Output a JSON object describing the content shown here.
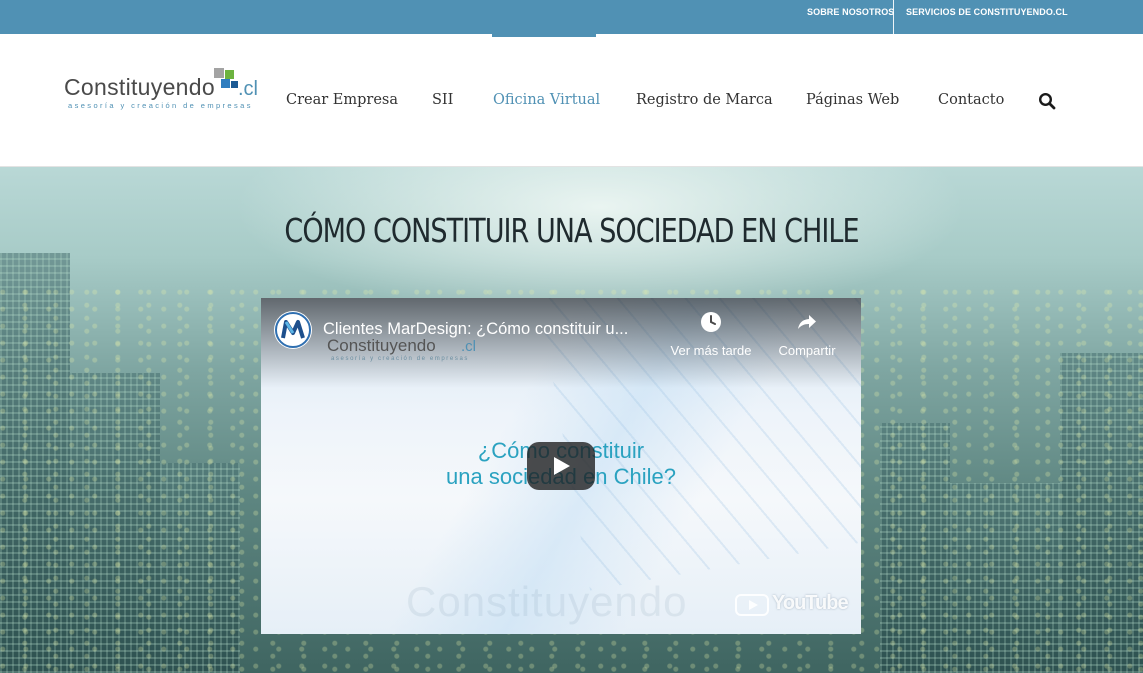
{
  "topbar": {
    "links": [
      "SOBRE NOSOTROS",
      "SERVICIOS DE CONSTITUYENDO.CL"
    ]
  },
  "logo": {
    "name": "Constituyendo",
    "suffix": ".cl",
    "tagline": "asesoría y creación de empresas"
  },
  "nav": {
    "items": [
      {
        "label": "Crear Empresa",
        "active": false
      },
      {
        "label": "SII",
        "active": false
      },
      {
        "label": "Oficina Virtual",
        "active": true
      },
      {
        "label": "Registro de Marca",
        "active": false
      },
      {
        "label": "Páginas Web",
        "active": false
      },
      {
        "label": "Contacto",
        "active": false
      }
    ],
    "search_icon": "search-icon"
  },
  "hero": {
    "title": "CÓMO CONSTITUIR UNA SOCIEDAD EN CHILE"
  },
  "video": {
    "title": "Clientes MarDesign: ¿Cómo constituir u...",
    "watch_later": "Ver más tarde",
    "share": "Compartir",
    "headline_line1": "¿Cómo constituir",
    "headline_line2": "una sociedad en Chile?",
    "logo_name": "Constituyendo",
    "logo_suffix": ".cl",
    "logo_tagline": "asesoría y creación de empresas",
    "watermark": "Constituyendo",
    "youtube_label": "YouTube"
  },
  "colors": {
    "accent": "#5091b4",
    "topbar": "#5091b4",
    "nav_text": "#333333",
    "video_headline": "#2aa2c0"
  }
}
